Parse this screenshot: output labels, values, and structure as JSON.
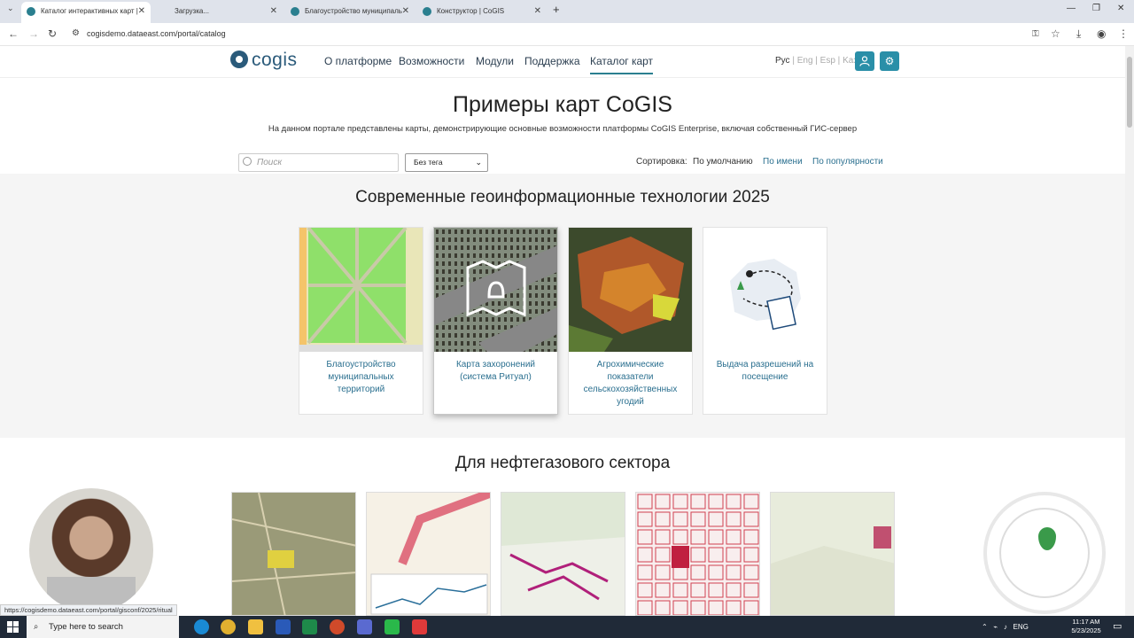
{
  "browser": {
    "tabs": [
      {
        "title": "Каталог интерактивных карт | "
      },
      {
        "title": "Загрузка..."
      },
      {
        "title": "Благоустройство муниципаль"
      },
      {
        "title": "Конструктор | CoGIS"
      }
    ],
    "new_tab": "+",
    "url": "cogisdemo.dataeast.com/portal/catalog",
    "status_url": "https://cogisdemo.dataeast.com/portal/gisconf/2025/ritual"
  },
  "site": {
    "logo": "cogis",
    "nav": [
      "О платформе",
      "Возможности",
      "Модули",
      "Поддержка",
      "Каталог карт"
    ],
    "languages": [
      "Рус",
      "Eng",
      "Esp",
      "Kaз"
    ],
    "language_separator": " | ",
    "user_icon": "user-icon",
    "settings_icon": "gear-icon"
  },
  "hero": {
    "title": "Примеры карт CoGIS",
    "subtitle": "На данном портале представлены карты, демонстрирующие основные возможности платформы CoGIS Enterprise, включая собственный ГИС-сервер"
  },
  "filters": {
    "search_placeholder": "Поиск",
    "tag_selected": "Без тега",
    "sort_label": "Сортировка:",
    "sort_options": [
      "По умолчанию",
      "По имени",
      "По популярности"
    ]
  },
  "sections": [
    {
      "title": "Современные геоинформационные технологии 2025",
      "cards": [
        {
          "caption": "Благоустройство муниципальных территорий"
        },
        {
          "caption": "Карта захоронений (система Ритуал)"
        },
        {
          "caption": "Агрохимические показатели сельскохозяйственных угодий"
        },
        {
          "caption": "Выдача разрешений на посещение"
        }
      ]
    },
    {
      "title": "Для нефтегазового сектора"
    }
  ],
  "taskbar": {
    "search_placeholder": "Type here to search",
    "language": "ENG",
    "time": "11:17 AM",
    "date": "5/23/2025"
  }
}
